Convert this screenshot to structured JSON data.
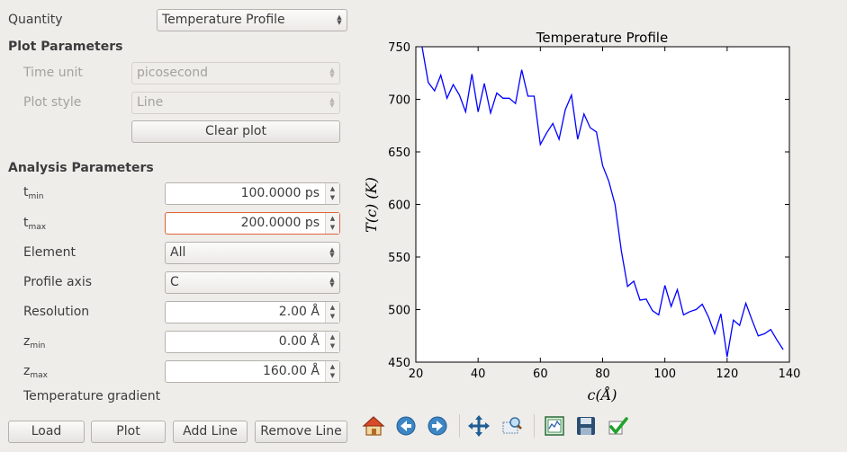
{
  "quantity": {
    "label": "Quantity",
    "value": "Temperature Profile"
  },
  "plot_params": {
    "heading": "Plot Parameters",
    "time_unit_label": "Time unit",
    "time_unit_value": "picosecond",
    "plot_style_label": "Plot style",
    "plot_style_value": "Line",
    "clear_plot": "Clear plot"
  },
  "analysis_params": {
    "heading": "Analysis Parameters",
    "tmin_main": "t",
    "tmin_sub": "min",
    "tmin_value": "100.0000 ps",
    "tmax_main": "t",
    "tmax_sub": "max",
    "tmax_value": "200.0000 ps",
    "element_label": "Element",
    "element_value": "All",
    "profile_axis_label": "Profile axis",
    "profile_axis_value": "C",
    "resolution_label": "Resolution",
    "resolution_value": "2.00 Å",
    "zmin_main": "z",
    "zmin_sub": "min",
    "zmin_value": "0.00 Å",
    "zmax_main": "z",
    "zmax_sub": "max",
    "zmax_value": "160.00 Å",
    "temp_gradient_label": "Temperature gradient"
  },
  "buttons": {
    "load": "Load",
    "plot": "Plot",
    "add_line": "Add Line",
    "remove_line": "Remove Line"
  },
  "toolbar": [
    "home-icon",
    "back-icon",
    "forward-icon",
    "pan-icon",
    "zoom-icon",
    "configure-subplots-icon",
    "save-icon",
    "edit-parameters-icon"
  ],
  "colors": {
    "line": "#0000ff",
    "focus_border": "#e0633a",
    "background": "#efedea"
  },
  "chart_data": {
    "type": "line",
    "title": "Temperature Profile",
    "xlabel": "c(Å)",
    "ylabel": "T(c) (K)",
    "xlim": [
      20,
      140
    ],
    "ylim": [
      450,
      750
    ],
    "xticks": [
      20,
      40,
      60,
      80,
      100,
      120,
      140
    ],
    "yticks": [
      450,
      500,
      550,
      600,
      650,
      700,
      750
    ],
    "grid": false,
    "series": [
      {
        "color": "#0000ff",
        "x": [
          22,
          24,
          26,
          28,
          30,
          32,
          34,
          36,
          38,
          40,
          42,
          44,
          46,
          48,
          50,
          52,
          54,
          56,
          58,
          60,
          62,
          64,
          66,
          68,
          70,
          72,
          74,
          76,
          78,
          80,
          82,
          84,
          86,
          88,
          90,
          92,
          94,
          96,
          98,
          100,
          102,
          104,
          106,
          108,
          110,
          112,
          114,
          116,
          118,
          120,
          122,
          124,
          126,
          128,
          130,
          132,
          134,
          136,
          138
        ],
        "y": [
          750,
          716,
          708,
          723,
          701,
          714,
          704,
          688,
          724,
          688,
          715,
          687,
          706,
          701,
          701,
          696,
          728,
          703,
          703,
          657,
          668,
          677,
          662,
          690,
          704,
          662,
          686,
          673,
          669,
          637,
          622,
          600,
          556,
          522,
          527,
          509,
          510,
          499,
          495,
          523,
          503,
          519,
          495,
          498,
          500,
          505,
          493,
          477,
          496,
          455,
          490,
          485,
          506,
          490,
          475,
          477,
          481,
          471,
          462
        ]
      }
    ]
  }
}
